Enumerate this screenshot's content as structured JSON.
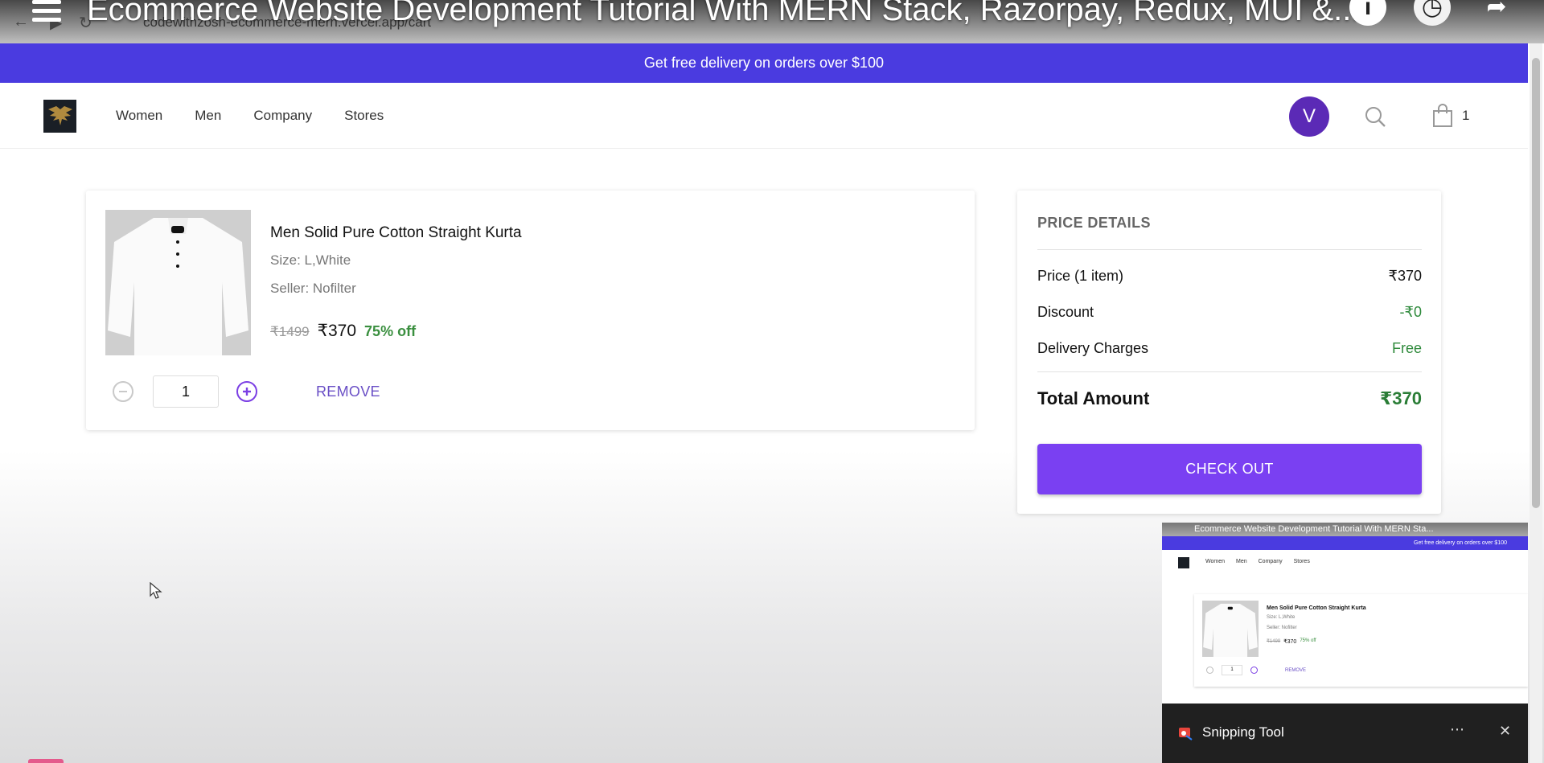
{
  "overlay": {
    "video_title": "Ecommerce Website Development Tutorial With MERN Stack, Razorpay, Redux, MUI &...",
    "url": "codewithzosh-ecommerce-mern.vercel.app/cart"
  },
  "promo": {
    "text": "Get free delivery on orders over $100",
    "color": "#4a3be0"
  },
  "header": {
    "nav": [
      "Women",
      "Men",
      "Company",
      "Stores"
    ],
    "avatar_letter": "V",
    "cart_count": "1"
  },
  "cart": {
    "item": {
      "name": "Men Solid Pure Cotton Straight Kurta",
      "size": "Size: L,White",
      "seller": "Seller: Nofilter",
      "original_price": "₹1499",
      "price": "₹370",
      "discount": "75% off",
      "quantity": "1",
      "remove_label": "REMOVE"
    }
  },
  "price_details": {
    "title": "PRICE DETAILS",
    "rows": [
      {
        "label": "Price (1 item)",
        "value": "₹370"
      },
      {
        "label": "Discount",
        "value": "-₹0"
      },
      {
        "label": "Delivery Charges",
        "value": "Free"
      }
    ],
    "total_label": "Total Amount",
    "total_value": "₹370",
    "checkout_label": "CHECK OUT",
    "accent": "#7a40f2"
  },
  "snipping_tool": {
    "app_name": "Snipping Tool",
    "preview_title": "Ecommerce Website Development Tutorial With MERN Sta...",
    "preview_promo": "Get free delivery on orders over $100",
    "preview_nav": [
      "Women",
      "Men",
      "Company",
      "Stores"
    ],
    "preview_name": "Men Solid Pure Cotton Straight Kurta",
    "preview_size": "Size: L,White",
    "preview_seller": "Seller: Nofilter",
    "preview_orig": "₹1499",
    "preview_price": "₹370",
    "preview_discount": "75% off",
    "preview_qty": "1",
    "preview_remove": "REMOVE",
    "more_icon": "ellipsis-icon",
    "close_icon": "close-icon"
  }
}
